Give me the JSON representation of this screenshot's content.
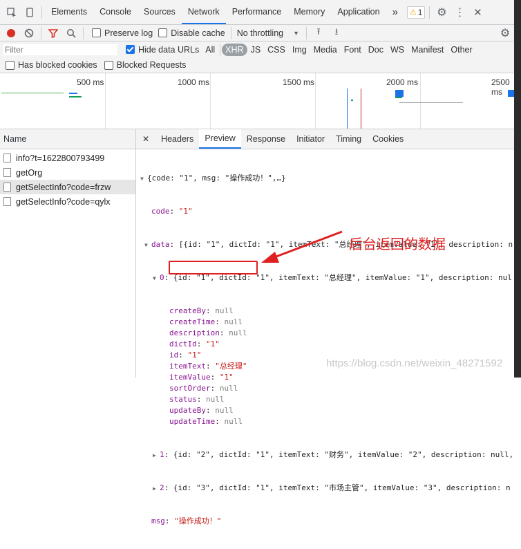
{
  "devtools": {
    "tabs": [
      "Elements",
      "Console",
      "Sources",
      "Network",
      "Performance",
      "Memory",
      "Application"
    ],
    "active_tab": "Network",
    "more": "»",
    "warning_count": "1"
  },
  "toolbar": {
    "preserve_log": "Preserve log",
    "disable_cache": "Disable cache",
    "throttling": "No throttling"
  },
  "filter": {
    "placeholder": "Filter",
    "hide_data_urls": "Hide data URLs",
    "types": [
      "All",
      "XHR",
      "JS",
      "CSS",
      "Img",
      "Media",
      "Font",
      "Doc",
      "WS",
      "Manifest",
      "Other"
    ],
    "selected_type": "XHR",
    "blocked_cookies": "Has blocked cookies",
    "blocked_requests": "Blocked Requests"
  },
  "timeline": {
    "labels": [
      "500 ms",
      "1000 ms",
      "1500 ms",
      "2000 ms",
      "2500 ms"
    ]
  },
  "requests": {
    "header": "Name",
    "items": [
      "info?t=1622800793499",
      "getOrg",
      "getSelectInfo?code=frzw",
      "getSelectInfo?code=qylx"
    ],
    "selected_index": 2
  },
  "detail_tabs": [
    "Headers",
    "Preview",
    "Response",
    "Initiator",
    "Timing",
    "Cookies"
  ],
  "active_detail_tab": "Preview",
  "preview": {
    "root": "{code: \"1\", msg: \"操作成功！\",…}",
    "code_key": "code",
    "code_val": "\"1\"",
    "data_key": "data",
    "data_summary": "[{id: \"1\", dictId: \"1\", itemText: \"总经理\", itemValue: \"1\", description: n",
    "item0_summary": "{id: \"1\", dictId: \"1\", itemText: \"总经理\", itemValue: \"1\", description: nul",
    "fields": [
      {
        "k": "createBy",
        "v": "null",
        "t": "n"
      },
      {
        "k": "createTime",
        "v": "null",
        "t": "n"
      },
      {
        "k": "description",
        "v": "null",
        "t": "n"
      },
      {
        "k": "dictId",
        "v": "\"1\"",
        "t": "s"
      },
      {
        "k": "id",
        "v": "\"1\"",
        "t": "s"
      },
      {
        "k": "itemText",
        "v": "\"总经理\"",
        "t": "s"
      },
      {
        "k": "itemValue",
        "v": "\"1\"",
        "t": "s"
      },
      {
        "k": "sortOrder",
        "v": "null",
        "t": "n"
      },
      {
        "k": "status",
        "v": "null",
        "t": "n"
      },
      {
        "k": "updateBy",
        "v": "null",
        "t": "n"
      },
      {
        "k": "updateTime",
        "v": "null",
        "t": "n"
      }
    ],
    "item1_summary": "{id: \"2\", dictId: \"1\", itemText: \"财务\", itemValue: \"2\", description: null,",
    "item2_summary": "{id: \"3\", dictId: \"1\", itemText: \"市场主管\", itemValue: \"3\", description: n",
    "msg_key": "msg",
    "msg_val": "\"操作成功！\""
  },
  "annotation": "后台返回的数据",
  "watermark": "https://blog.csdn.net/weixin_48271592",
  "colors": {
    "accent": "#1a73e8",
    "annotation": "#e02020",
    "key": "#881391",
    "string": "#c41a16"
  }
}
